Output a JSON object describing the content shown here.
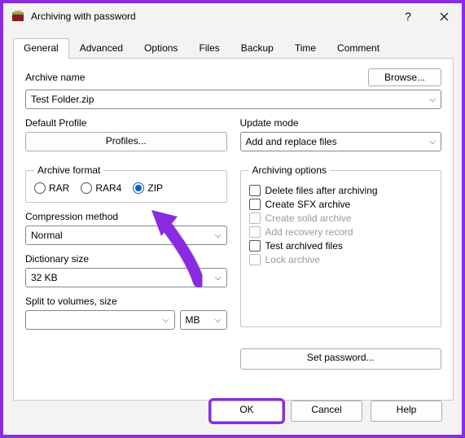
{
  "window": {
    "title": "Archiving with password"
  },
  "tabs": [
    "General",
    "Advanced",
    "Options",
    "Files",
    "Backup",
    "Time",
    "Comment"
  ],
  "active_tab": 0,
  "labels": {
    "archive_name": "Archive name",
    "browse": "Browse...",
    "default_profile": "Default Profile",
    "profiles_btn": "Profiles...",
    "update_mode": "Update mode",
    "archive_format": "Archive format",
    "archiving_options": "Archiving options",
    "compression_method": "Compression method",
    "dictionary_size": "Dictionary size",
    "split_volumes": "Split to volumes, size",
    "set_password": "Set password...",
    "ok": "OK",
    "cancel": "Cancel",
    "help": "Help"
  },
  "values": {
    "archive_name": "Test Folder.zip",
    "update_mode": "Add and replace files",
    "compression_method": "Normal",
    "dictionary_size": "32 KB",
    "split_value": "",
    "split_unit": "MB"
  },
  "formats": {
    "rar": "RAR",
    "rar4": "RAR4",
    "zip": "ZIP",
    "selected": "zip"
  },
  "options": [
    {
      "key": "delete",
      "label": "Delete files after archiving",
      "enabled": true
    },
    {
      "key": "sfx",
      "label": "Create SFX archive",
      "enabled": true
    },
    {
      "key": "solid",
      "label": "Create solid archive",
      "enabled": false
    },
    {
      "key": "recovery",
      "label": "Add recovery record",
      "enabled": false
    },
    {
      "key": "test",
      "label": "Test archived files",
      "enabled": true
    },
    {
      "key": "lock",
      "label": "Lock archive",
      "enabled": false
    }
  ]
}
